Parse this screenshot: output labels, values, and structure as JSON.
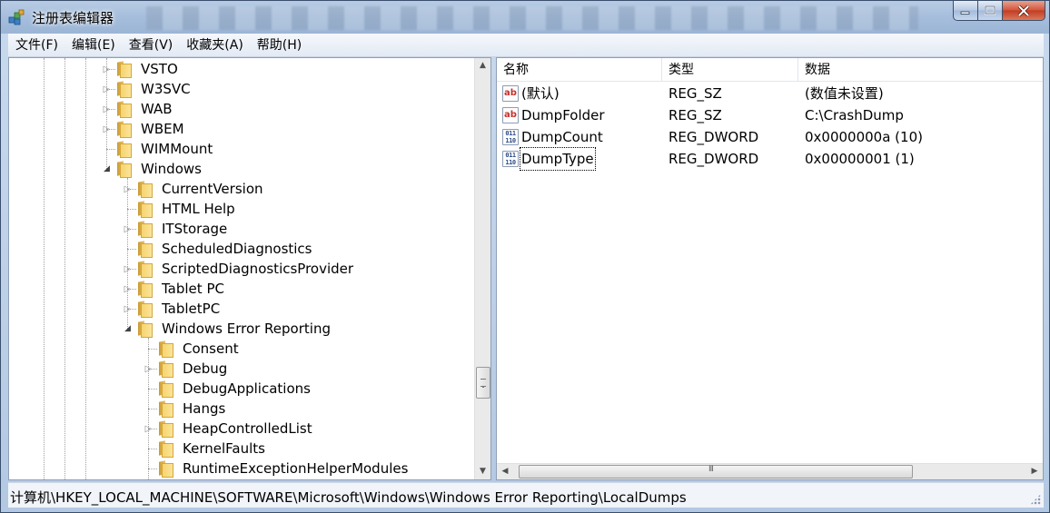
{
  "window": {
    "title": "注册表编辑器"
  },
  "menu": {
    "items": [
      {
        "label": "文件(F)"
      },
      {
        "label": "编辑(E)"
      },
      {
        "label": "查看(V)"
      },
      {
        "label": "收藏夹(A)"
      },
      {
        "label": "帮助(H)"
      }
    ]
  },
  "tree": {
    "nodes": [
      {
        "label": "VSTO",
        "state": "collapsed"
      },
      {
        "label": "W3SVC",
        "state": "collapsed"
      },
      {
        "label": "WAB",
        "state": "collapsed"
      },
      {
        "label": "WBEM",
        "state": "collapsed"
      },
      {
        "label": "WIMMount",
        "state": "leaf"
      },
      {
        "label": "Windows",
        "state": "expanded"
      },
      {
        "label": "CurrentVersion",
        "state": "collapsed"
      },
      {
        "label": "HTML Help",
        "state": "leaf"
      },
      {
        "label": "ITStorage",
        "state": "collapsed"
      },
      {
        "label": "ScheduledDiagnostics",
        "state": "leaf"
      },
      {
        "label": "ScriptedDiagnosticsProvider",
        "state": "collapsed"
      },
      {
        "label": "Tablet PC",
        "state": "collapsed"
      },
      {
        "label": "TabletPC",
        "state": "collapsed"
      },
      {
        "label": "Windows Error Reporting",
        "state": "expanded"
      },
      {
        "label": "Consent",
        "state": "leaf"
      },
      {
        "label": "Debug",
        "state": "collapsed"
      },
      {
        "label": "DebugApplications",
        "state": "leaf"
      },
      {
        "label": "Hangs",
        "state": "leaf"
      },
      {
        "label": "HeapControlledList",
        "state": "collapsed"
      },
      {
        "label": "KernelFaults",
        "state": "leaf"
      },
      {
        "label": "RuntimeExceptionHelperModules",
        "state": "leaf"
      }
    ]
  },
  "values_list": {
    "columns": [
      "名称",
      "类型",
      "数据"
    ],
    "rows": [
      {
        "icon": "string-value-icon",
        "name": "(默认)",
        "type": "REG_SZ",
        "data": "(数值未设置)"
      },
      {
        "icon": "string-value-icon",
        "name": "DumpFolder",
        "type": "REG_SZ",
        "data": "C:\\CrashDump"
      },
      {
        "icon": "dword-value-icon",
        "name": "DumpCount",
        "type": "REG_DWORD",
        "data": "0x0000000a (10)"
      },
      {
        "icon": "dword-value-icon",
        "name": "DumpType",
        "type": "REG_DWORD",
        "data": "0x00000001 (1)"
      }
    ],
    "icon_text": {
      "string": "ab",
      "dword": "011 110"
    }
  },
  "statusbar": {
    "path": "计算机\\HKEY_LOCAL_MACHINE\\SOFTWARE\\Microsoft\\Windows\\Windows Error Reporting\\LocalDumps"
  },
  "colors": {
    "title_bar": "#a6bedc",
    "close_button": "#c23b22",
    "folder": "#f6d36f"
  }
}
